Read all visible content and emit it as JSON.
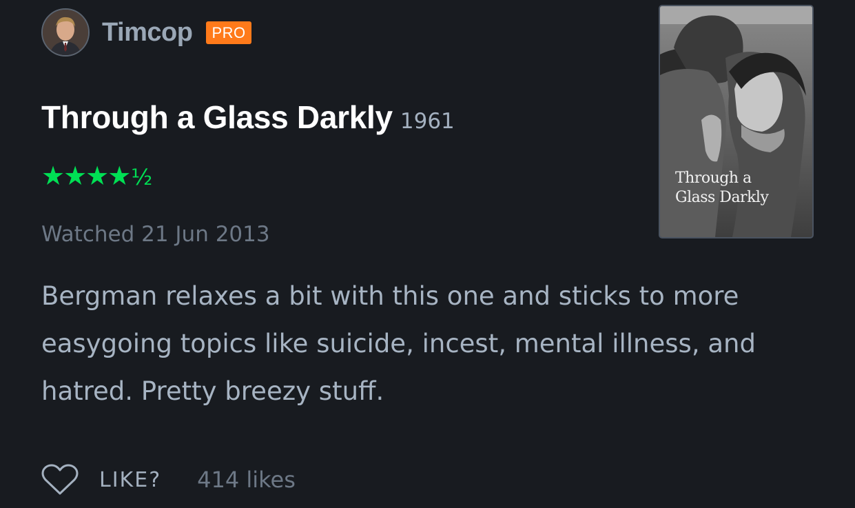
{
  "header": {
    "username": "Timcop",
    "badge": "PRO"
  },
  "film": {
    "title": "Through a Glass Darkly",
    "year": "1961",
    "rating": 4.5,
    "rating_stars": "★★★★",
    "rating_half": "½",
    "watched": "Watched 21 Jun 2013",
    "poster_title_line1": "Through a",
    "poster_title_line2": "Glass Darkly"
  },
  "review": {
    "text": "Bergman relaxes a bit with this one and sticks to more easygoing topics like suicide, incest, mental illness, and hatred. Pretty breezy stuff."
  },
  "footer": {
    "like_label": "LIKE?",
    "likes_count": "414 likes"
  },
  "colors": {
    "background": "#181b20",
    "rating_green": "#00e054",
    "pro_badge": "#ff7a1a"
  },
  "icons": {
    "like": "heart-icon"
  }
}
